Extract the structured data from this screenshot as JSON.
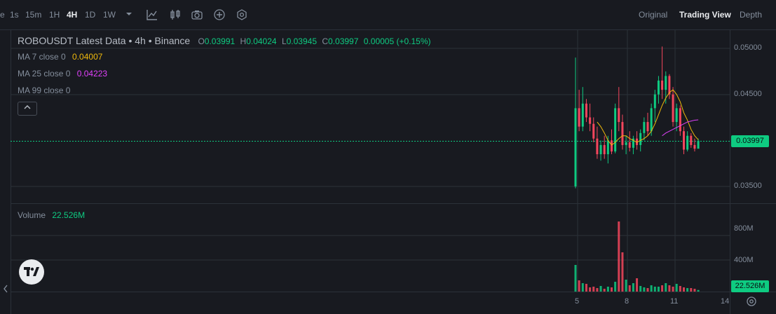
{
  "toolbar": {
    "partial_first": "e",
    "timeframes": [
      "1s",
      "15m",
      "1H",
      "4H",
      "1D",
      "1W"
    ],
    "active": "4H",
    "views": [
      "Original",
      "Trading View",
      "Depth"
    ],
    "active_view": "Trading View",
    "icons": [
      "chevron-down-icon",
      "indicator-icon",
      "candle-type-icon",
      "camera-icon",
      "add-icon",
      "settings-icon"
    ]
  },
  "legend": {
    "title": "ROBOUSDT Latest Data • 4h • Binance",
    "ohlc": [
      {
        "k": "O",
        "v": "0.03991"
      },
      {
        "k": "H",
        "v": "0.04024"
      },
      {
        "k": "L",
        "v": "0.03945"
      },
      {
        "k": "C",
        "v": "0.03997"
      }
    ],
    "change": "0.00005 (+0.15%)",
    "ma7_label": "MA 7 close 0",
    "ma7_value": "0.04007",
    "ma25_label": "MA 25 close 0",
    "ma25_value": "0.04223",
    "ma99_label": "MA 99 close 0",
    "volume_label": "Volume",
    "volume_value": "22.526M"
  },
  "price_axis": [
    "0.05000",
    "0.04500",
    "0.03500"
  ],
  "current_price": "0.03997",
  "volume_axis": [
    "800M",
    "400M"
  ],
  "current_volume": "22.526M",
  "time_axis": [
    "5",
    "8",
    "11",
    "14"
  ],
  "colors": {
    "up": "#0ecb81",
    "down": "#f6465d",
    "ma7": "#f0b90b",
    "ma25": "#e040fb",
    "bg": "#181a20"
  },
  "chart_data": {
    "type": "candlestick",
    "y_range": [
      0.0345,
      0.0505
    ],
    "x_ticks": [
      "5",
      "8",
      "11",
      "14"
    ],
    "candles": [
      {
        "o": 0.035,
        "h": 0.049,
        "l": 0.0348,
        "c": 0.0435
      },
      {
        "o": 0.0435,
        "h": 0.0455,
        "l": 0.041,
        "c": 0.0415
      },
      {
        "o": 0.0415,
        "h": 0.0458,
        "l": 0.041,
        "c": 0.044
      },
      {
        "o": 0.044,
        "h": 0.0445,
        "l": 0.042,
        "c": 0.0425
      },
      {
        "o": 0.0425,
        "h": 0.044,
        "l": 0.041,
        "c": 0.0418
      },
      {
        "o": 0.0418,
        "h": 0.0425,
        "l": 0.0398,
        "c": 0.0402
      },
      {
        "o": 0.0402,
        "h": 0.0415,
        "l": 0.038,
        "c": 0.0385
      },
      {
        "o": 0.0385,
        "h": 0.04,
        "l": 0.0378,
        "c": 0.0395
      },
      {
        "o": 0.0395,
        "h": 0.0405,
        "l": 0.038,
        "c": 0.0385
      },
      {
        "o": 0.0385,
        "h": 0.0405,
        "l": 0.0375,
        "c": 0.04
      },
      {
        "o": 0.04,
        "h": 0.0412,
        "l": 0.0385,
        "c": 0.0388
      },
      {
        "o": 0.0388,
        "h": 0.044,
        "l": 0.0386,
        "c": 0.0435
      },
      {
        "o": 0.0435,
        "h": 0.0458,
        "l": 0.041,
        "c": 0.042
      },
      {
        "o": 0.042,
        "h": 0.0428,
        "l": 0.039,
        "c": 0.0395
      },
      {
        "o": 0.0395,
        "h": 0.0405,
        "l": 0.0385,
        "c": 0.0398
      },
      {
        "o": 0.0398,
        "h": 0.041,
        "l": 0.0388,
        "c": 0.0392
      },
      {
        "o": 0.0392,
        "h": 0.0405,
        "l": 0.0385,
        "c": 0.0402
      },
      {
        "o": 0.0402,
        "h": 0.041,
        "l": 0.039,
        "c": 0.0395
      },
      {
        "o": 0.0395,
        "h": 0.0412,
        "l": 0.0388,
        "c": 0.0408
      },
      {
        "o": 0.0408,
        "h": 0.0425,
        "l": 0.04,
        "c": 0.042
      },
      {
        "o": 0.042,
        "h": 0.043,
        "l": 0.0405,
        "c": 0.041
      },
      {
        "o": 0.041,
        "h": 0.044,
        "l": 0.0405,
        "c": 0.0435
      },
      {
        "o": 0.0435,
        "h": 0.0455,
        "l": 0.042,
        "c": 0.045
      },
      {
        "o": 0.045,
        "h": 0.047,
        "l": 0.044,
        "c": 0.0465
      },
      {
        "o": 0.0465,
        "h": 0.0502,
        "l": 0.0445,
        "c": 0.0455
      },
      {
        "o": 0.0455,
        "h": 0.0475,
        "l": 0.044,
        "c": 0.047
      },
      {
        "o": 0.047,
        "h": 0.0472,
        "l": 0.0445,
        "c": 0.045
      },
      {
        "o": 0.045,
        "h": 0.0458,
        "l": 0.0415,
        "c": 0.042
      },
      {
        "o": 0.042,
        "h": 0.044,
        "l": 0.041,
        "c": 0.0435
      },
      {
        "o": 0.0435,
        "h": 0.0438,
        "l": 0.0405,
        "c": 0.041
      },
      {
        "o": 0.041,
        "h": 0.0415,
        "l": 0.0385,
        "c": 0.039
      },
      {
        "o": 0.039,
        "h": 0.041,
        "l": 0.0388,
        "c": 0.0405
      },
      {
        "o": 0.0405,
        "h": 0.0408,
        "l": 0.0392,
        "c": 0.0395
      },
      {
        "o": 0.0395,
        "h": 0.0402,
        "l": 0.0388,
        "c": 0.0391
      },
      {
        "o": 0.0391,
        "h": 0.0402,
        "l": 0.0394,
        "c": 0.03997
      }
    ],
    "ma7": [
      null,
      null,
      null,
      null,
      null,
      null,
      0.042,
      0.0415,
      0.0408,
      0.04,
      0.0395,
      0.0398,
      0.0402,
      0.0405,
      0.0405,
      0.0402,
      0.04,
      0.0398,
      0.04,
      0.0402,
      0.0405,
      0.041,
      0.0418,
      0.0428,
      0.0438,
      0.0446,
      0.0452,
      0.0455,
      0.045,
      0.0442,
      0.043,
      0.0422,
      0.0412,
      0.0405,
      0.04007
    ],
    "ma25": [
      null,
      null,
      null,
      null,
      null,
      null,
      null,
      null,
      null,
      null,
      null,
      null,
      null,
      null,
      null,
      null,
      null,
      null,
      null,
      null,
      null,
      null,
      null,
      null,
      0.0405,
      0.0408,
      0.041,
      0.0412,
      0.0414,
      0.0416,
      0.0418,
      0.042,
      0.0421,
      0.0422,
      0.04223
    ],
    "volume_range": [
      0,
      1050
    ],
    "volumes": [
      380,
      160,
      120,
      110,
      60,
      70,
      50,
      80,
      40,
      70,
      60,
      140,
      1000,
      560,
      170,
      90,
      120,
      190,
      80,
      60,
      50,
      90,
      70,
      70,
      90,
      120,
      90,
      70,
      110,
      80,
      60,
      50,
      50,
      40,
      22.526
    ]
  }
}
